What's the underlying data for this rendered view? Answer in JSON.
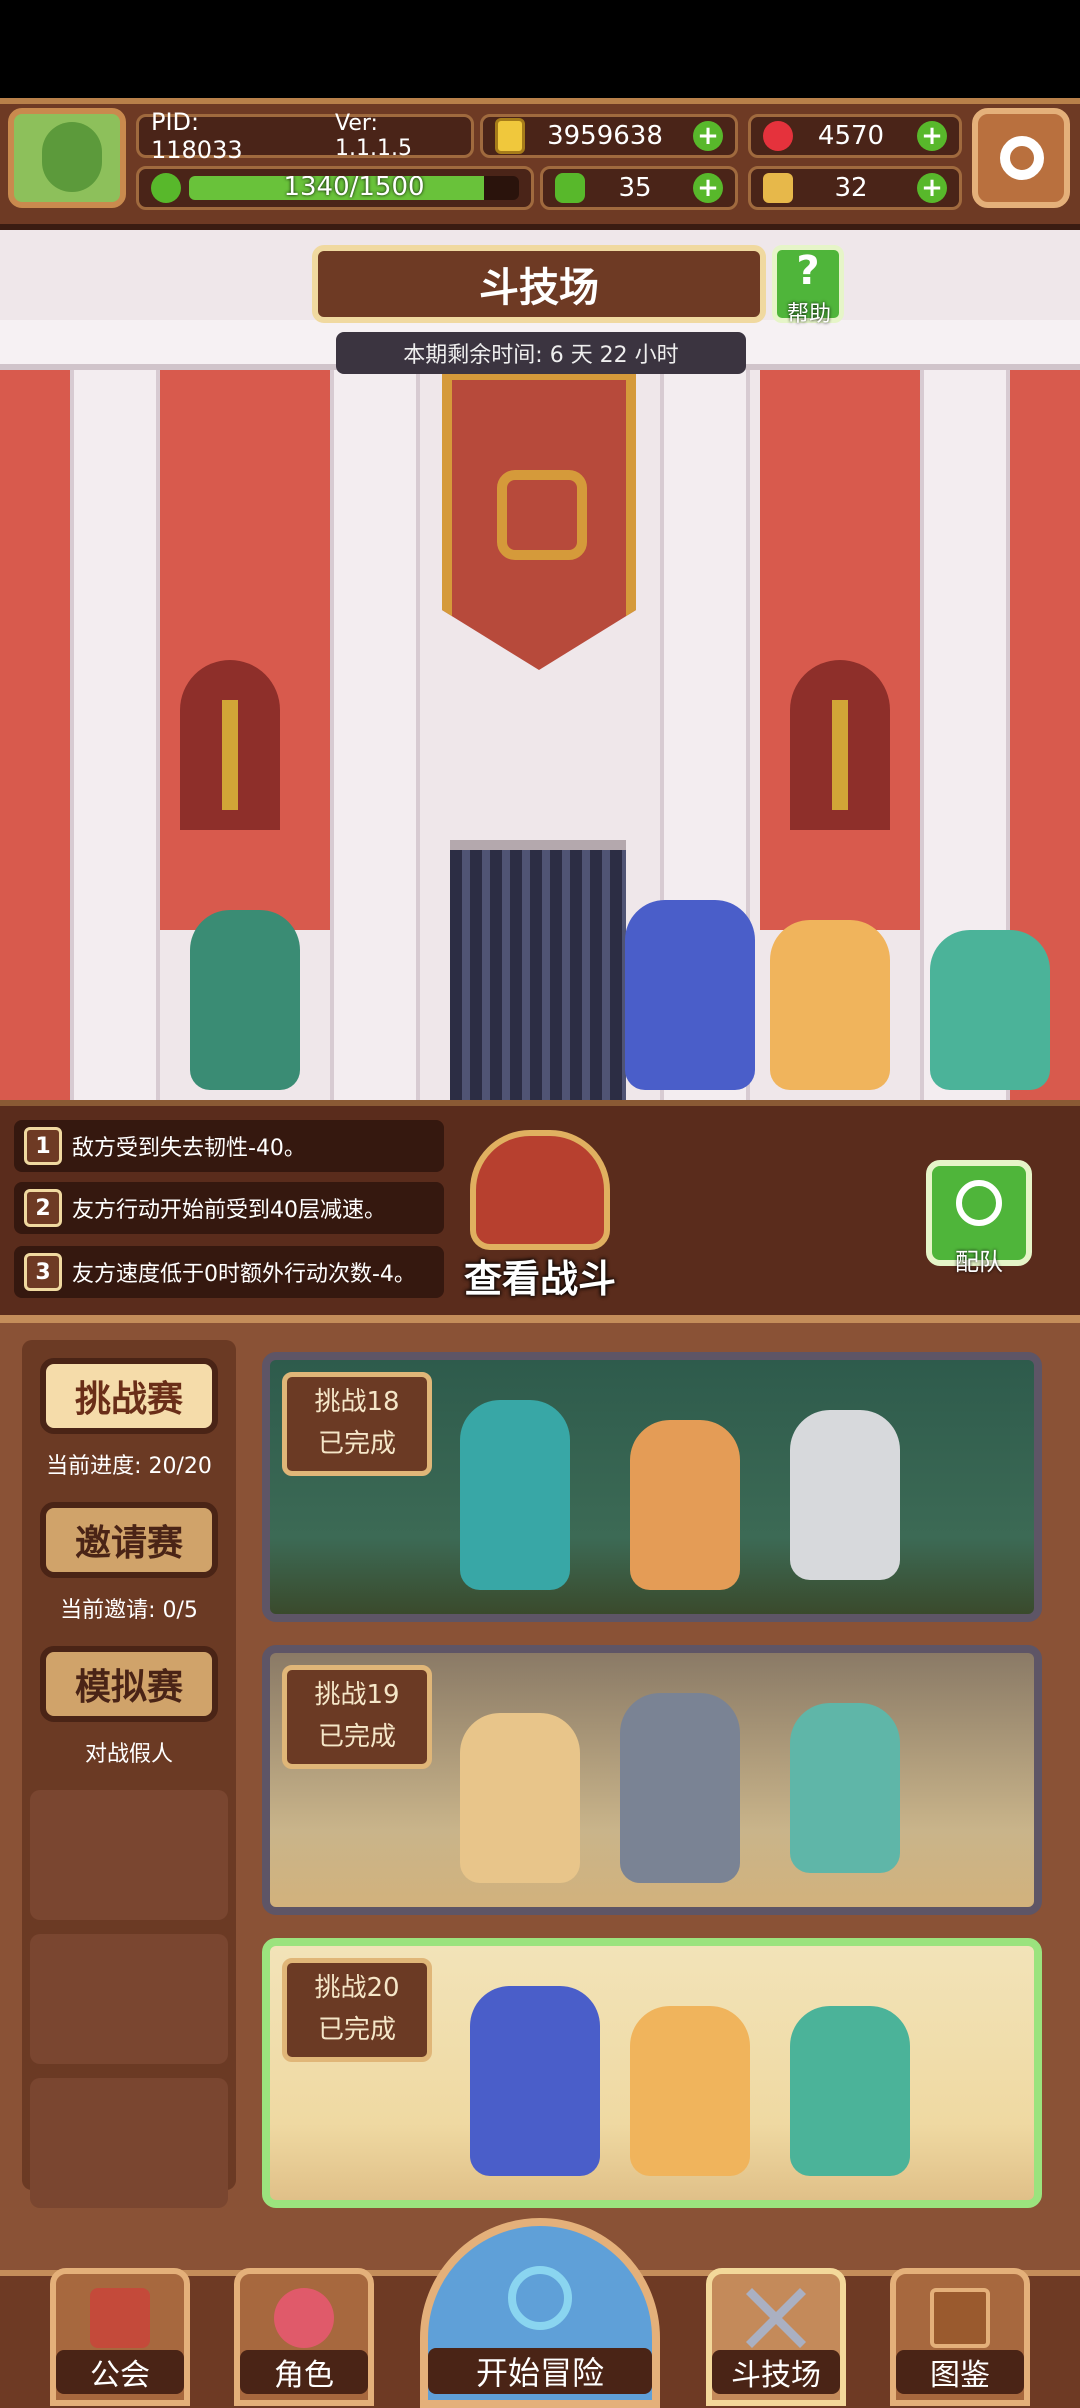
{
  "header": {
    "pid": "PID: 118033",
    "version": "Ver: 1.1.1.5",
    "gold": "3959638",
    "gems": "4570",
    "stamina": "1340/1500",
    "clover": "35",
    "keys": "32",
    "plus": "+"
  },
  "arena": {
    "title": "斗技场",
    "help_label": "帮助",
    "help_glyph": "?",
    "timer": "本期剩余时间: 6 天 22 小时"
  },
  "rules": [
    {
      "num": "1",
      "text": "敌方受到失去韧性-40。"
    },
    {
      "num": "2",
      "text": "友方行动开始前受到40层减速。"
    },
    {
      "num": "3",
      "text": "友方速度低于0时额外行动次数-4。"
    }
  ],
  "battle": {
    "view_label": "查看战斗",
    "formation_label": "配队"
  },
  "side_menu": {
    "challenge": {
      "label": "挑战赛",
      "sub": "当前进度: 20/20"
    },
    "invite": {
      "label": "邀请赛",
      "sub": "当前邀请: 0/5"
    },
    "simulate": {
      "label": "模拟赛",
      "sub": "对战假人"
    }
  },
  "challenges": [
    {
      "title": "挑战18",
      "status": "已完成"
    },
    {
      "title": "挑战19",
      "status": "已完成"
    },
    {
      "title": "挑战20",
      "status": "已完成"
    }
  ],
  "nav": {
    "guild": "公会",
    "character": "角色",
    "adventure": "开始冒险",
    "arena": "斗技场",
    "codex": "图鉴"
  },
  "colors": {
    "accent_green": "#4fb53a",
    "panel_brown": "#6e3a24",
    "wall_red": "#d85a4d"
  }
}
